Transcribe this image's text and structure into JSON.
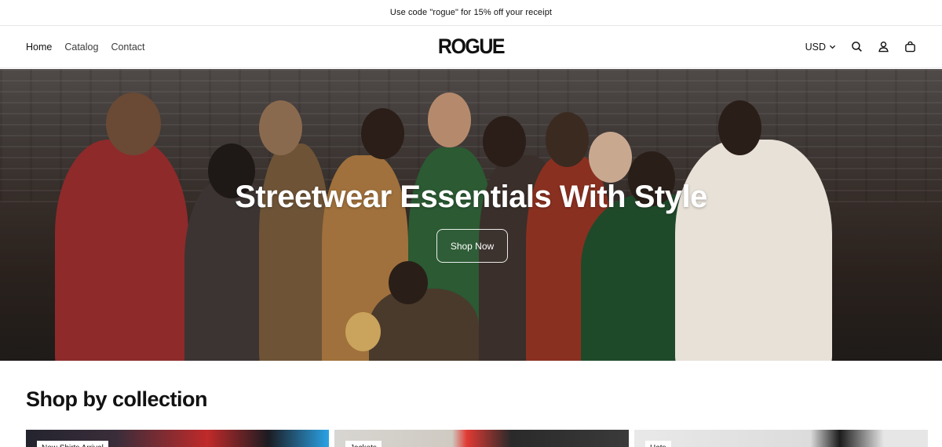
{
  "announcement": "Use code \"rogue\" for 15% off your receipt",
  "nav": {
    "items": [
      "Home",
      "Catalog",
      "Contact"
    ]
  },
  "brand": "ROGUE",
  "header": {
    "currency": "USD"
  },
  "hero": {
    "title": "Streetwear Essentials With Style",
    "button": "Shop Now"
  },
  "collections": {
    "title": "Shop by collection",
    "items": [
      "New Shirts Arrival",
      "Jackets",
      "Hats"
    ]
  },
  "icons": [
    "chevron-down-icon",
    "search-icon",
    "account-icon",
    "bag-icon"
  ]
}
